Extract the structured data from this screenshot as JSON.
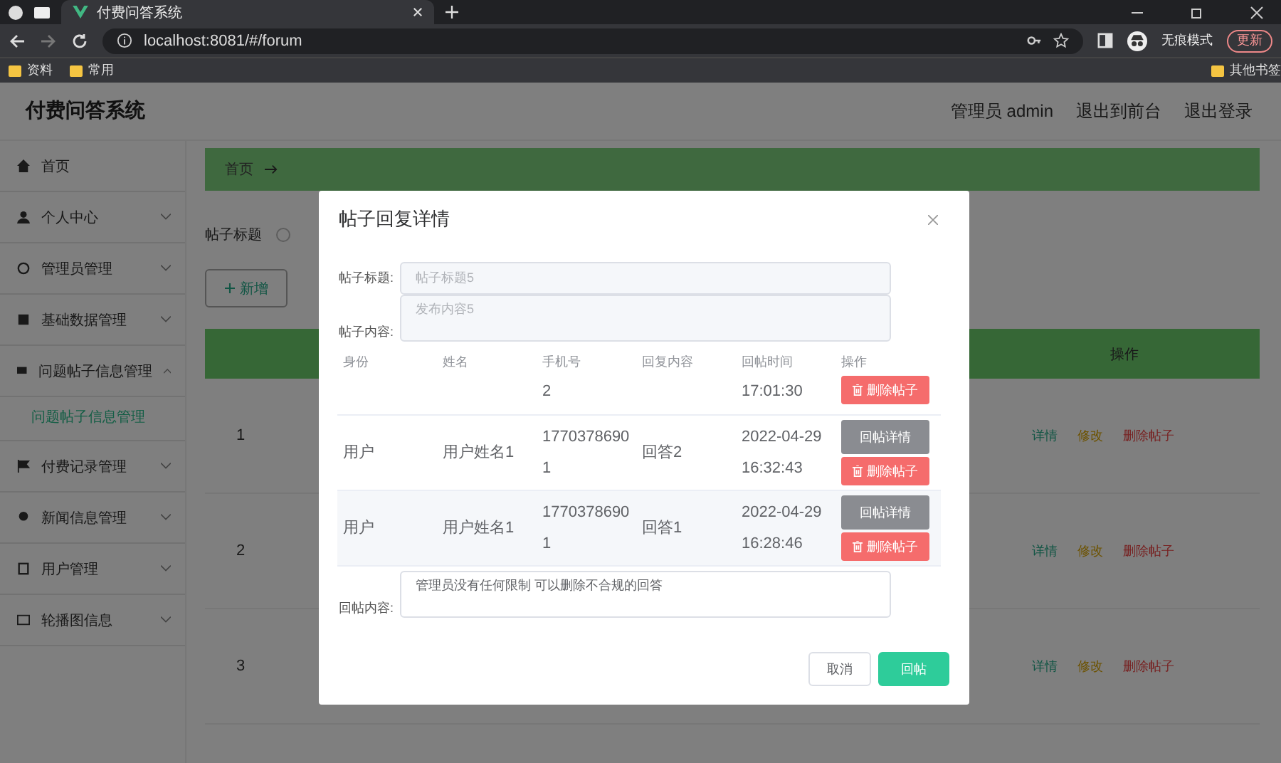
{
  "browser": {
    "tab_title": "付费问答系统",
    "url": "localhost:8081/#/forum",
    "profile_label": "无痕模式",
    "update_button": "更新",
    "bookmarks": [
      "资料",
      "常用"
    ],
    "other_bookmarks": "其他书签"
  },
  "app": {
    "title": "付费问答系统",
    "header_links": [
      "管理员 admin",
      "退出到前台",
      "退出登录"
    ]
  },
  "sidebar": {
    "items": [
      {
        "label": "首页"
      },
      {
        "label": "个人中心",
        "expanded": false
      },
      {
        "label": "管理员管理",
        "expanded": false
      },
      {
        "label": "基础数据管理",
        "expanded": false
      },
      {
        "label": "问题帖子信息管理",
        "expanded": true,
        "children": [
          {
            "label": "问题帖子信息管理",
            "selected": true
          }
        ]
      },
      {
        "label": "付费记录管理",
        "expanded": false
      },
      {
        "label": "新闻信息管理",
        "expanded": false
      },
      {
        "label": "用户管理",
        "expanded": false
      },
      {
        "label": "轮播图信息",
        "expanded": false
      }
    ]
  },
  "breadcrumb": {
    "home": "首页"
  },
  "search": {
    "label": "帖子标题"
  },
  "add_button": "新增",
  "table": {
    "action_header": "操作",
    "rows": [
      {
        "index": "1",
        "actions": [
          {
            "label": "详情",
            "kind": "detail"
          },
          {
            "label": "修改",
            "kind": "edit"
          },
          {
            "label": "删除帖子",
            "kind": "delete"
          }
        ]
      },
      {
        "index": "2",
        "actions": [
          {
            "label": "详情",
            "kind": "detail"
          },
          {
            "label": "修改",
            "kind": "edit"
          },
          {
            "label": "删除帖子",
            "kind": "delete"
          }
        ]
      },
      {
        "index": "3",
        "actions": [
          {
            "label": "详情",
            "kind": "detail"
          },
          {
            "label": "修改",
            "kind": "edit"
          },
          {
            "label": "删除帖子",
            "kind": "delete"
          }
        ]
      }
    ]
  },
  "dialog": {
    "title": "帖子回复详情",
    "fields": [
      {
        "label": "帖子标题:",
        "value": "帖子标题5",
        "disabled": true,
        "kind": "input"
      },
      {
        "label": "帖子内容:",
        "value": "发布内容5",
        "disabled": true,
        "kind": "textarea"
      }
    ],
    "columns": [
      "身份",
      "姓名",
      "手机号",
      "回复内容",
      "回帖时间",
      "操作"
    ],
    "rows": [
      {
        "phone": "2",
        "time": "17:01:30",
        "actions": [
          {
            "label": "删除帖子",
            "kind": "delete"
          }
        ]
      },
      {
        "role": "用户",
        "name": "用户姓名1",
        "phone": "17703786901",
        "reply": "回答2",
        "time": "2022-04-29 16:32:43",
        "actions": [
          {
            "label": "回帖详情",
            "kind": "detail"
          },
          {
            "label": "删除帖子",
            "kind": "delete"
          }
        ]
      },
      {
        "role": "用户",
        "name": "用户姓名1",
        "phone": "17703786901",
        "reply": "回答1",
        "time": "2022-04-29 16:28:46",
        "actions": [
          {
            "label": "回帖详情",
            "kind": "detail"
          },
          {
            "label": "删除帖子",
            "kind": "delete"
          }
        ]
      }
    ],
    "reply": {
      "label": "回帖内容:",
      "value": "管理员没有任何限制 可以删除不合规的回答"
    },
    "buttons": [
      {
        "label": "取消",
        "kind": "default"
      },
      {
        "label": "回帖",
        "kind": "primary"
      }
    ]
  }
}
